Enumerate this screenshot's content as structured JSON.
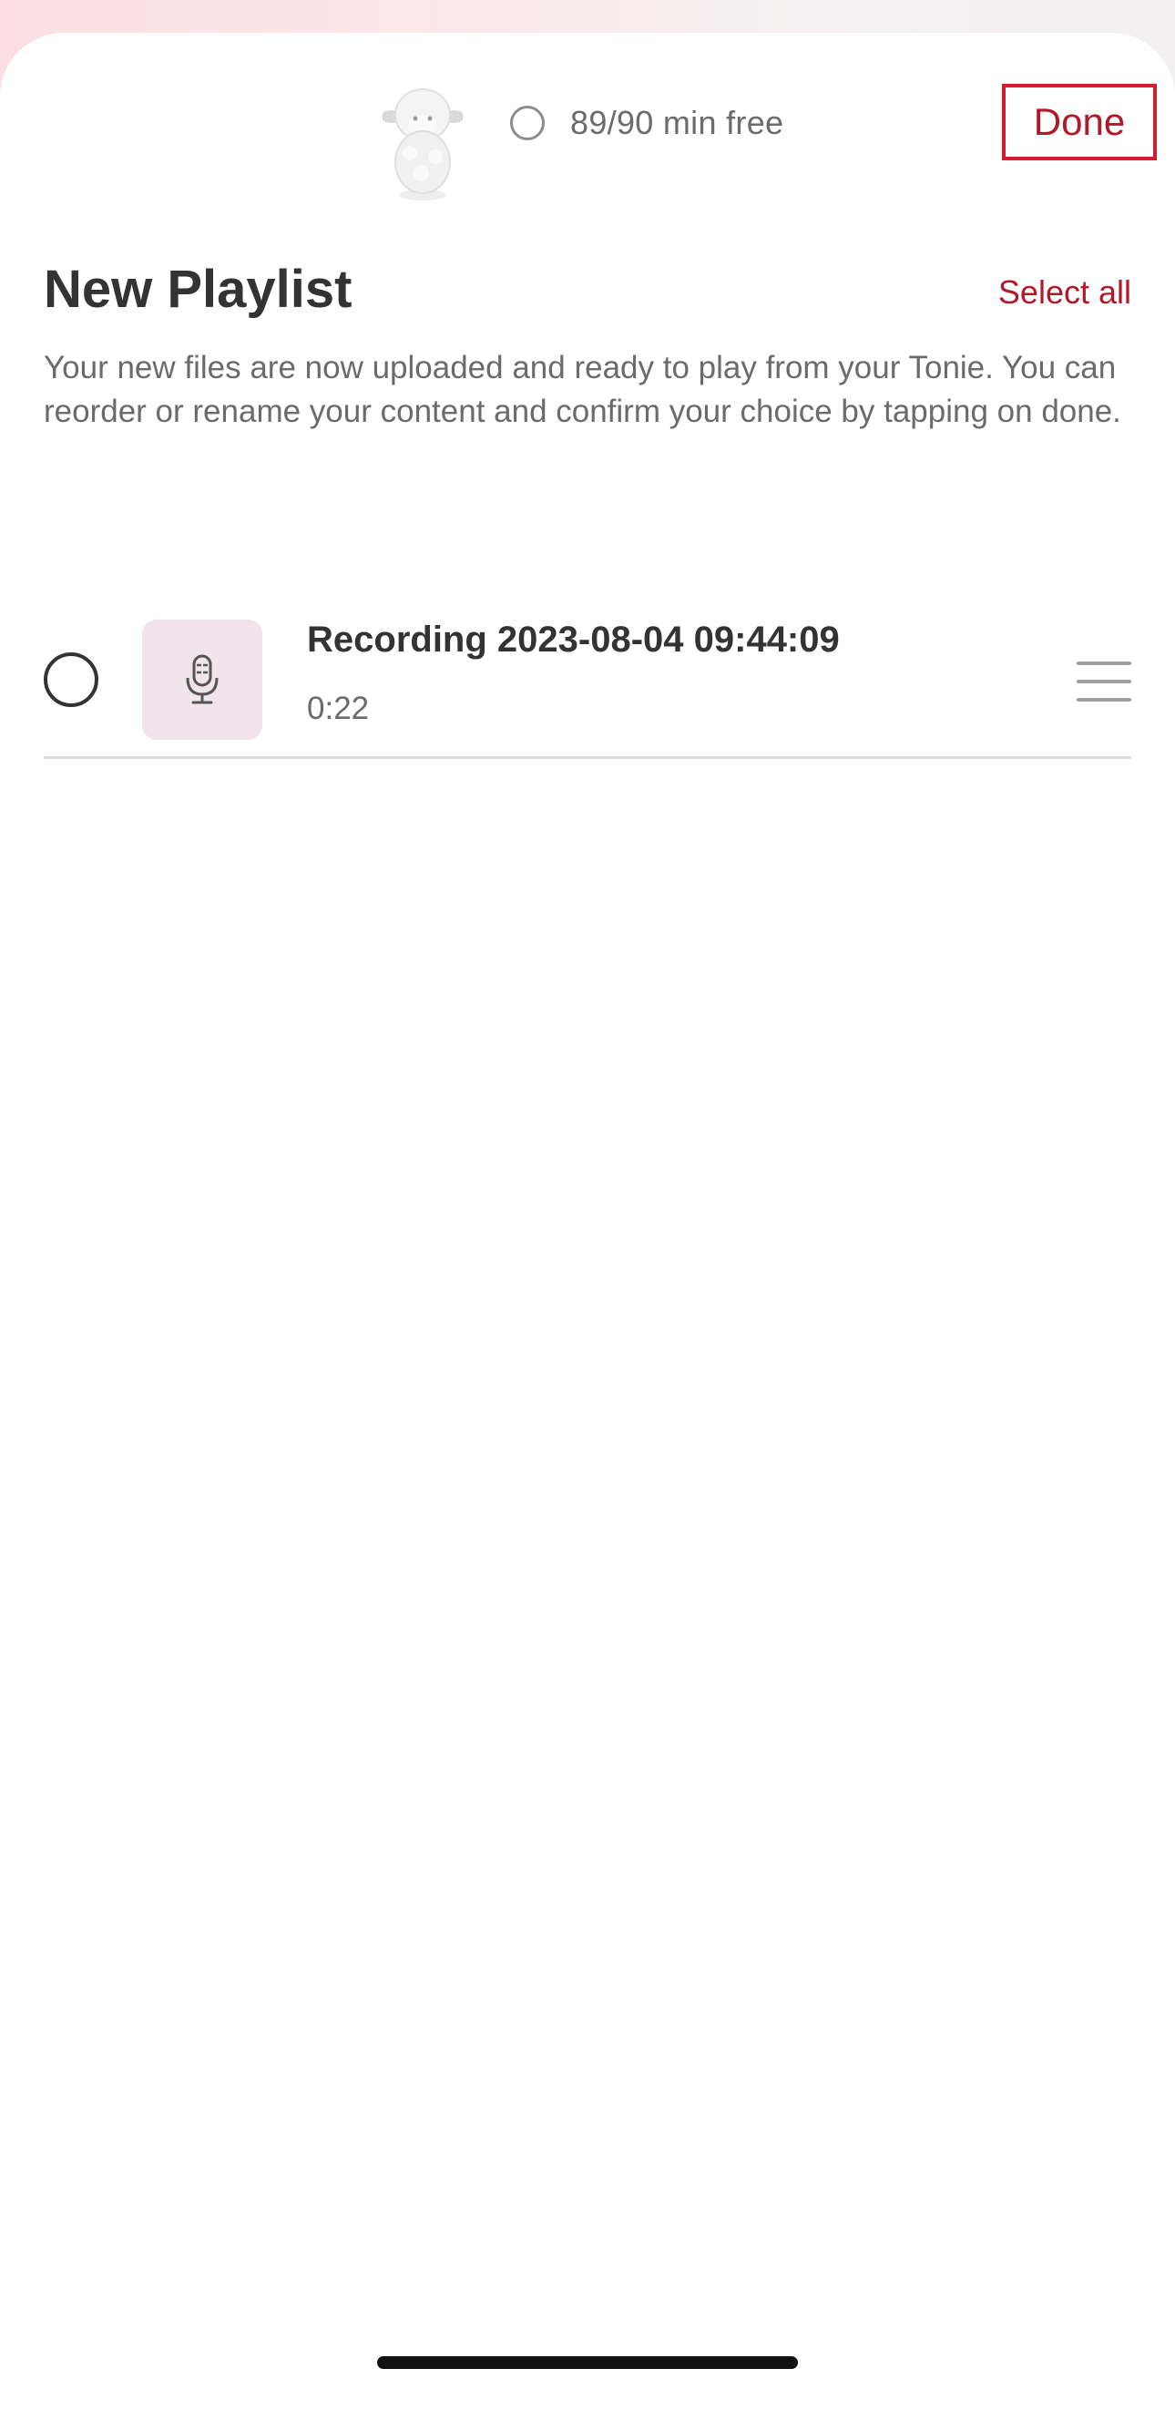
{
  "header": {
    "capacity_text": "89/90 min free",
    "done_label": "Done"
  },
  "page": {
    "title": "New Playlist",
    "select_all_label": "Select all",
    "description": "Your new files are now uploaded and ready to play from your Tonie. You can reorder or rename your content and confirm your choice by tapping on done."
  },
  "items": [
    {
      "title": "Recording 2023-08-04 09:44:09",
      "duration": "0:22",
      "icon": "microphone-icon",
      "selected": false
    }
  ],
  "colors": {
    "accent": "#b3182a",
    "done_outline": "#d61a2e",
    "thumb_bg": "#f1e4ea",
    "text_primary": "#333333",
    "text_secondary": "#6b6b6b"
  }
}
